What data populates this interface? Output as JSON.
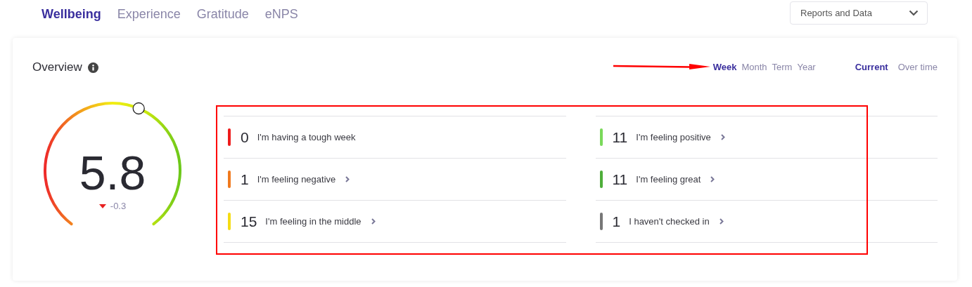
{
  "nav_tabs": [
    {
      "label": "Wellbeing",
      "selected": true
    },
    {
      "label": "Experience",
      "selected": false
    },
    {
      "label": "Gratitude",
      "selected": false
    },
    {
      "label": "eNPS",
      "selected": false
    }
  ],
  "reports_dropdown": {
    "label": "Reports and Data"
  },
  "overview": {
    "title": "Overview",
    "periods": [
      {
        "label": "Week",
        "selected": true
      },
      {
        "label": "Month",
        "selected": false
      },
      {
        "label": "Term",
        "selected": false
      },
      {
        "label": "Year",
        "selected": false
      }
    ],
    "views": [
      {
        "label": "Current",
        "selected": true
      },
      {
        "label": "Over time",
        "selected": false
      }
    ],
    "gauge": {
      "score": "5.8",
      "change": "-0.3"
    },
    "moods": [
      {
        "count": "0",
        "label": "I'm having a tough week",
        "color": "#ee1c1c",
        "link": false
      },
      {
        "count": "1",
        "label": "I'm feeling negative",
        "color": "#f07a1e",
        "link": true
      },
      {
        "count": "15",
        "label": "I'm feeling in the middle",
        "color": "#f5dc14",
        "link": true
      },
      {
        "count": "11",
        "label": "I'm feeling positive",
        "color": "#7ad95a",
        "link": true
      },
      {
        "count": "11",
        "label": "I'm feeling great",
        "color": "#4eae3a",
        "link": true
      },
      {
        "count": "1",
        "label": "I haven't checked in",
        "color": "#777777",
        "link": true
      }
    ]
  }
}
